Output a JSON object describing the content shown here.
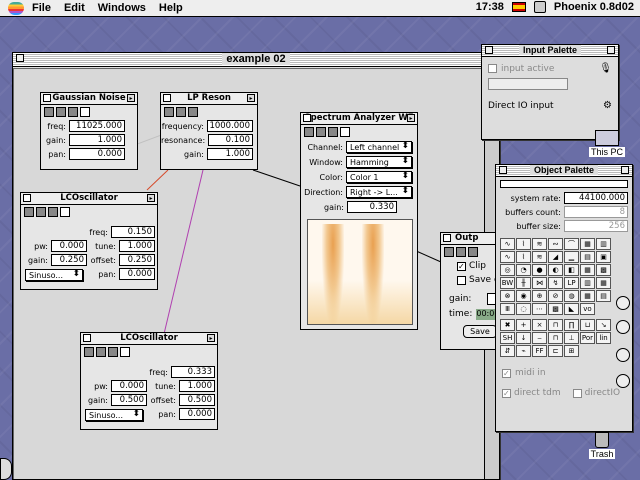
{
  "menubar": {
    "items": [
      "File",
      "Edit",
      "Windows",
      "Help"
    ],
    "time": "17:38",
    "app_name": "Phoenix 0.8d02"
  },
  "desktop": {
    "icons": [
      {
        "name": "This PC"
      },
      {
        "name": "Trash"
      }
    ]
  },
  "main_window": {
    "title": "example 02",
    "objects": {
      "gaussian": {
        "title": "Gaussian Noise",
        "freq_label": "freq:",
        "freq": "11025.000",
        "gain_label": "gain:",
        "gain": "1.000",
        "pan_label": "pan:",
        "pan": "0.000"
      },
      "lpreson": {
        "title": "LP Reson",
        "frequency_label": "frequency:",
        "frequency": "1000.000",
        "resonance_label": "resonance:",
        "resonance": "0.100",
        "gain_label": "gain:",
        "gain": "1.000"
      },
      "lco1": {
        "title": "LCOscillator",
        "freq_label": "freq:",
        "freq": "0.150",
        "pw_label": "pw:",
        "pw": "0.000",
        "tune_label": "tune:",
        "tune": "1.000",
        "gain_label": "gain:",
        "gain": "0.250",
        "offset_label": "offset:",
        "offset": "0.250",
        "pan_label": "pan:",
        "pan": "0.000",
        "wave": "Sinuso..."
      },
      "lco2": {
        "title": "LCOscillator",
        "freq_label": "freq:",
        "freq": "0.333",
        "pw_label": "pw:",
        "pw": "0.000",
        "tune_label": "tune:",
        "tune": "1.000",
        "gain_label": "gain:",
        "gain": "0.500",
        "offset_label": "offset:",
        "offset": "0.500",
        "pan_label": "pan:",
        "pan": "0.000",
        "wave": "Sinuso..."
      },
      "spectrum": {
        "title": "Spectrum Analyzer WF",
        "channel_label": "Channel:",
        "channel": "Left channel",
        "window_label": "Window:",
        "window": "Hamming",
        "color_label": "Color:",
        "color": "Color 1",
        "direction_label": "Direction:",
        "direction": "Right -> L...",
        "gain_label": "gain:",
        "gain": "0.330"
      },
      "output": {
        "title": "Outp",
        "clip": "Clip",
        "save": "Save d",
        "gain_label": "gain:",
        "time_label": "time:",
        "time_value": "00:00",
        "save_button": "Save"
      }
    }
  },
  "input_palette": {
    "title": "Input Palette",
    "input_active": "input active",
    "direct_io": "Direct IO input"
  },
  "object_palette": {
    "title": "Object Palette",
    "system_rate_label": "system rate:",
    "system_rate": "44100.000",
    "buffers_count_label": "buffers count:",
    "buffers_count": "8",
    "buffer_size_label": "buffer size:",
    "buffer_size": "256",
    "midi_in": "midi in",
    "direct_tdm": "direct tdm",
    "direct_io": "directIO",
    "sample_labels": {
      "hold": "SH",
      "lin": "lin",
      "por": "Por",
      "lp": "LP\nRes"
    }
  },
  "colors": {
    "desktop": "#6a6ea6",
    "link_red": "#d64a2a",
    "link_purple": "#b040b0"
  }
}
